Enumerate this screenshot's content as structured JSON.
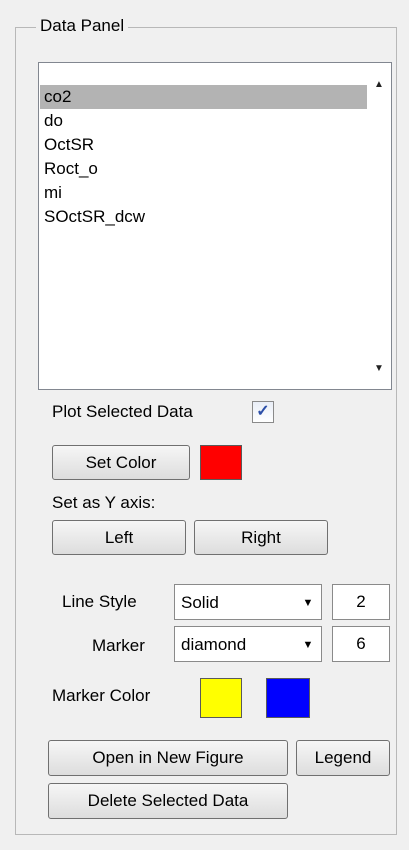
{
  "panel": {
    "title": "Data Panel"
  },
  "data_list": {
    "items": [
      "co2",
      "do",
      "OctSR",
      "Roct_o",
      "mi",
      "SOctSR_dcw"
    ],
    "selected_index": 0
  },
  "plot_selected": {
    "label": "Plot Selected Data",
    "checked": true,
    "check_glyph": "✓"
  },
  "color": {
    "button_label": "Set Color",
    "swatch_hex": "#ff0000"
  },
  "y_axis": {
    "label": "Set as Y axis:",
    "left_label": "Left",
    "right_label": "Right"
  },
  "line_style": {
    "label": "Line Style",
    "value": "Solid",
    "width": "2"
  },
  "marker": {
    "label": "Marker",
    "value": "diamond",
    "size": "6"
  },
  "marker_color": {
    "label": "Marker Color",
    "face_hex": "#ffff00",
    "edge_hex": "#0000ff"
  },
  "actions": {
    "open_new_figure": "Open in New Figure",
    "legend": "Legend",
    "delete_selected": "Delete Selected Data"
  },
  "icons": {
    "scroll_up": "▲",
    "scroll_down": "▼",
    "dropdown": "▼"
  }
}
